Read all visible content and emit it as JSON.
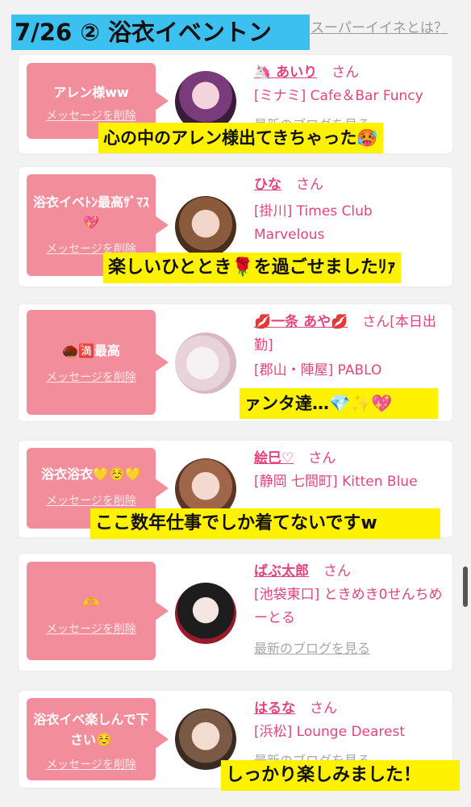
{
  "header": {
    "title": "7/26 ② 浴衣イベントン",
    "link": "スーパーイイネとは？"
  },
  "common": {
    "delete_label": "メッセージを削除",
    "san": "さん",
    "blog_label": "最新のブログを見る"
  },
  "cards": [
    {
      "message": "アレン様ww",
      "name": "🦄 あいり",
      "shop": "[ミナミ] Cafe＆Bar Funcy",
      "blog": "最新のブログを見る",
      "caption": "心の中のアレン様出てきちゃった🥵"
    },
    {
      "message": "浴衣イベﾄﾝ最高ｻﾞﾏｽ💖",
      "name": "ひな",
      "shop": "[掛川] Times Club Marvelous",
      "caption": "楽しいひととき🌹を過ごせましたﾘｧ"
    },
    {
      "message": "🌰🈵最高",
      "name": "💋一条 あや💋",
      "shop_prefix": "[本日出勤]",
      "shop": "[郡山・陣屋] PABLO",
      "caption": "ァンタ達…💎✨💖"
    },
    {
      "message": "浴衣浴衣💛☺️💛",
      "name": "絵巳♡",
      "shop": "[静岡 七間町] Kitten Blue",
      "caption": "ここ数年仕事でしか着てないですw"
    },
    {
      "message": "🫶",
      "name": "ばぶ太郎",
      "shop": "[池袋東口] ときめき0せんちめーとる",
      "blog": "最新のブログを見る"
    },
    {
      "message": "浴衣イベ楽しんで下さい☺️",
      "name": "はるな",
      "shop": "[浜松] Lounge Dearest",
      "blog": "最新のブログを見る",
      "caption": "しっかり楽しみました！"
    }
  ],
  "colors": {
    "bubble": "#f28e9b",
    "accent": "#e0457b",
    "caption_bg": "#fff200",
    "title_bg": "#3cc0f0"
  }
}
